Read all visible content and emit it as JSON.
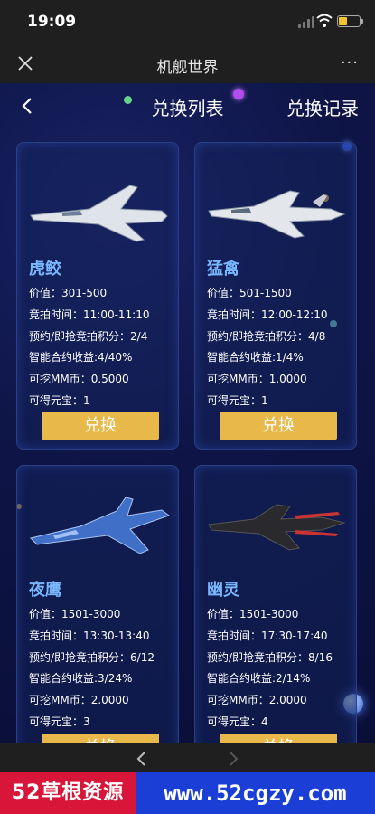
{
  "status_bar": {
    "time": "19:09"
  },
  "nav": {
    "title": "机舰世界",
    "more": "···"
  },
  "header": {
    "title": "兑换列表",
    "right_link": "兑换记录"
  },
  "cards": [
    {
      "name": "虎鲛",
      "price": "价值：301-500",
      "time": "竞拍时间：11:00-11:10",
      "points": "预约/即抢竞拍积分：2/4",
      "yield": "智能合约收益:4/40%",
      "mm": "可挖MM币：0.5000",
      "ingot": "可得元宝：1",
      "button": "兑换"
    },
    {
      "name": "猛禽",
      "price": "价值：501-1500",
      "time": "竞拍时间：12:00-12:10",
      "points": "预约/即抢竞拍积分：4/8",
      "yield": "智能合约收益:1/4%",
      "mm": "可挖MM币：1.0000",
      "ingot": "可得元宝：1",
      "button": "兑换"
    },
    {
      "name": "夜鹰",
      "price": "价值：1501-3000",
      "time": "竞拍时间：13:30-13:40",
      "points": "预约/即抢竞拍积分：6/12",
      "yield": "智能合约收益:3/24%",
      "mm": "可挖MM币：2.0000",
      "ingot": "可得元宝：3",
      "button": "兑换"
    },
    {
      "name": "幽灵",
      "price": "价值：1501-3000",
      "time": "竞拍时间：17:30-17:40",
      "points": "预约/即抢竞拍积分：8/16",
      "yield": "智能合约收益:2/14%",
      "mm": "可挖MM币：2.0000",
      "ingot": "可得元宝：4",
      "button": "兑换"
    }
  ],
  "banner": {
    "left": "52草根资源",
    "right": "www.52cgzy.com"
  },
  "colors": {
    "accent_button": "#e8b94a",
    "card_name": "#79b8ff",
    "battery": "#f4c430"
  }
}
